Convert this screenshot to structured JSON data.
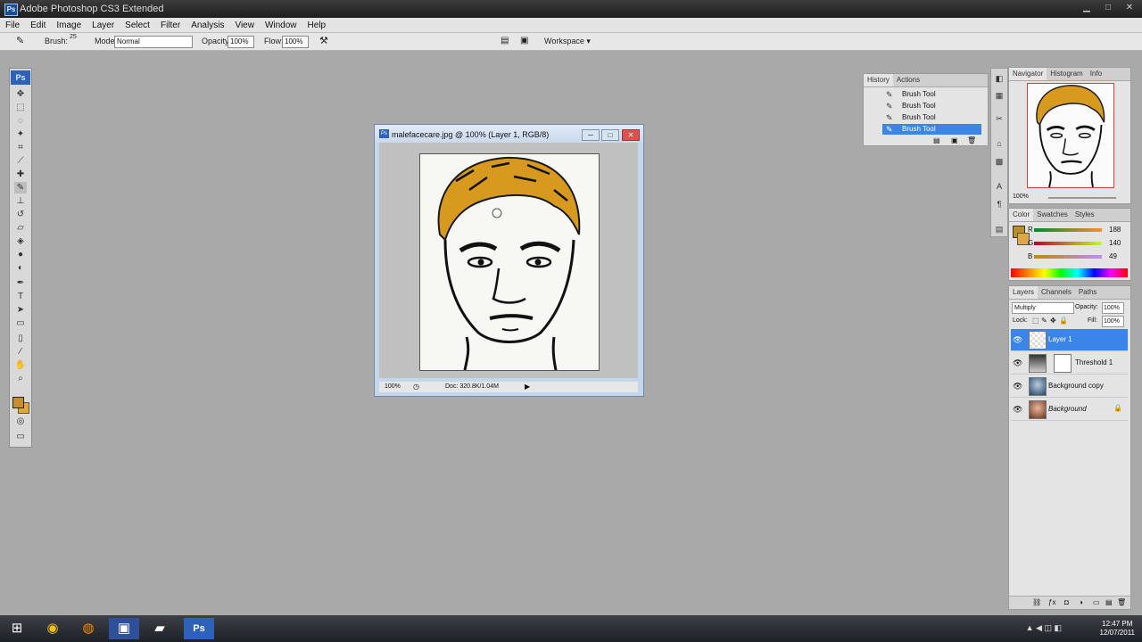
{
  "app": {
    "title": "Adobe Photoshop CS3 Extended",
    "icon": "photoshop-icon"
  },
  "menu": [
    "File",
    "Edit",
    "Image",
    "Layer",
    "Select",
    "Filter",
    "Analysis",
    "View",
    "Window",
    "Help"
  ],
  "options": {
    "brush_label": "Brush:",
    "brush_size": "25",
    "mode_label": "Mode:",
    "mode_value": "Normal",
    "opacity_label": "Opacity:",
    "opacity_value": "100%",
    "flow_label": "Flow:",
    "flow_value": "100%",
    "workspace_label": "Workspace ▾"
  },
  "document": {
    "title": "malefacecare.jpg @ 100% (Layer 1, RGB/8)",
    "zoom": "100%",
    "doc_info": "Doc: 320.8K/1.04M"
  },
  "history": {
    "tabs": [
      "History",
      "Actions"
    ],
    "items": [
      "Brush Tool",
      "Brush Tool",
      "Brush Tool",
      "Brush Tool"
    ],
    "selected_index": 3
  },
  "navigator": {
    "tabs": [
      "Navigator",
      "Histogram",
      "Info"
    ],
    "zoom": "100%"
  },
  "color": {
    "tabs": [
      "Color",
      "Swatches",
      "Styles"
    ],
    "r_label": "R",
    "r_value": "188",
    "g_label": "G",
    "g_value": "140",
    "b_label": "B",
    "b_value": "49",
    "foreground_hex": "#bc8c31"
  },
  "layers": {
    "tabs": [
      "Layers",
      "Channels",
      "Paths"
    ],
    "blend_mode": "Multiply",
    "opacity_label": "Opacity:",
    "opacity_value": "100%",
    "lock_label": "Lock:",
    "fill_label": "Fill:",
    "fill_value": "100%",
    "items": [
      {
        "name": "Layer 1",
        "selected": true
      },
      {
        "name": "Threshold 1",
        "selected": false
      },
      {
        "name": "Background copy",
        "selected": false
      },
      {
        "name": "Background",
        "selected": false
      }
    ]
  },
  "taskbar": {
    "time": "12:47 PM",
    "date": "12/07/2011"
  }
}
